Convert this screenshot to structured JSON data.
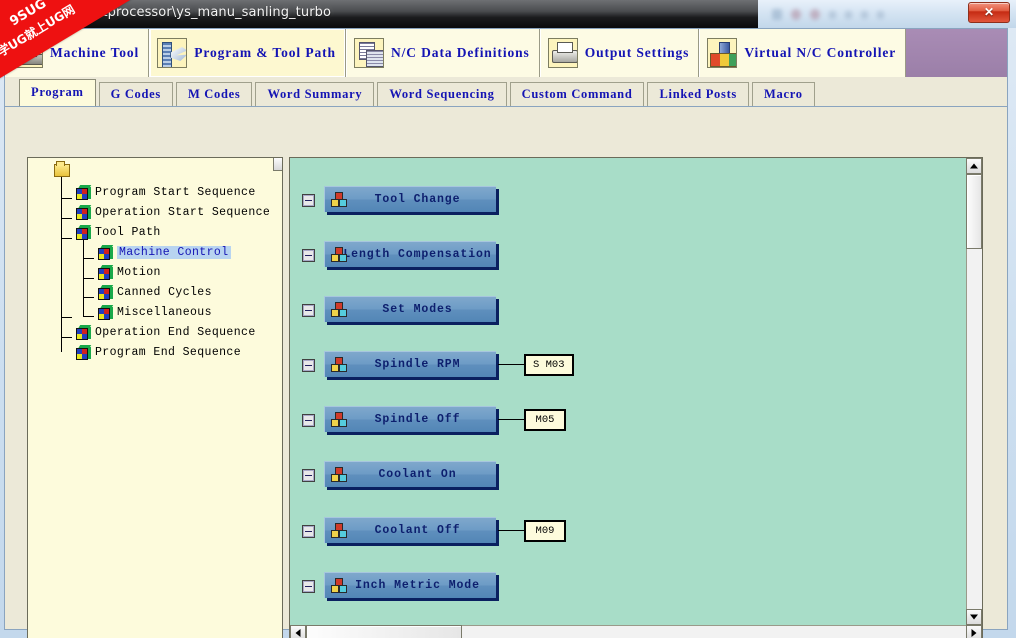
{
  "window": {
    "title": "...\\postprocessor\\ys_manu_sanling_turbo",
    "close_label": "✕"
  },
  "watermark": {
    "line1": "9SUG",
    "line2": "学UG就上UG网"
  },
  "toolbar": {
    "items": [
      {
        "label": "Machine Tool",
        "icon": "machine-tool-icon",
        "selected": false
      },
      {
        "label": "Program & Tool Path",
        "icon": "program-tool-path-icon",
        "selected": true
      },
      {
        "label": "N/C Data Definitions",
        "icon": "nc-data-definitions-icon",
        "selected": false
      },
      {
        "label": "Output Settings",
        "icon": "printer-icon",
        "selected": false
      },
      {
        "label": "Virtual N/C Controller",
        "icon": "virtual-controller-icon",
        "selected": false
      }
    ]
  },
  "tabs": {
    "items": [
      {
        "label": "Program",
        "active": true
      },
      {
        "label": "G Codes",
        "active": false
      },
      {
        "label": "M Codes",
        "active": false
      },
      {
        "label": "Word Summary",
        "active": false
      },
      {
        "label": "Word Sequencing",
        "active": false
      },
      {
        "label": "Custom Command",
        "active": false
      },
      {
        "label": "Linked Posts",
        "active": false
      },
      {
        "label": "Macro",
        "active": false
      }
    ]
  },
  "tree": {
    "root_icon": "folder-icon",
    "nodes": [
      {
        "label": "Program Start Sequence",
        "level": 0,
        "selected": false
      },
      {
        "label": "Operation Start Sequence",
        "level": 0,
        "selected": false
      },
      {
        "label": "Tool Path",
        "level": 0,
        "selected": false
      },
      {
        "label": "Machine Control",
        "level": 1,
        "selected": true
      },
      {
        "label": "Motion",
        "level": 1,
        "selected": false
      },
      {
        "label": "Canned Cycles",
        "level": 1,
        "selected": false
      },
      {
        "label": "Miscellaneous",
        "level": 1,
        "selected": false
      },
      {
        "label": "Operation End Sequence",
        "level": 0,
        "selected": false
      },
      {
        "label": "Program End Sequence",
        "level": 0,
        "selected": false
      }
    ]
  },
  "diagram": {
    "blocks": [
      {
        "label": "Tool Change",
        "code": ""
      },
      {
        "label": "Length Compensation",
        "code": ""
      },
      {
        "label": "Set Modes",
        "code": ""
      },
      {
        "label": "Spindle RPM",
        "code": "S M03"
      },
      {
        "label": "Spindle Off",
        "code": "M05"
      },
      {
        "label": "Coolant On",
        "code": ""
      },
      {
        "label": "Coolant Off",
        "code": "M09"
      },
      {
        "label": "Inch Metric Mode",
        "code": ""
      }
    ]
  },
  "colors": {
    "toolbar_bg": "#9b7fa8",
    "tab_text": "#1414b4",
    "canvas_bg": "#a8ddc8",
    "block_fill": "#6d9cc6",
    "block_text": "#0d1f6e",
    "tree_bg": "#fdfbdc",
    "selection": "#b8d4f0",
    "watermark": "#ee1111"
  }
}
